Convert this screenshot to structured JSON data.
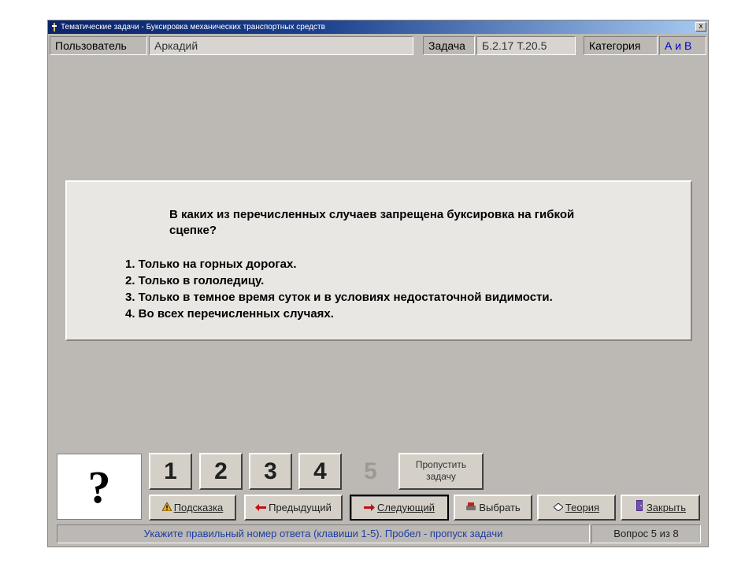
{
  "window": {
    "title": "Тематические задачи - Буксировка механических транспортных средств",
    "close_label": "x"
  },
  "infobar": {
    "user_label": "Пользователь",
    "user_value": "Аркадий",
    "task_label": "Задача",
    "task_value": "Б.2.17  Т.20.5",
    "category_label": "Категория",
    "category_value": "А и В"
  },
  "question": {
    "text": "В каких из перечисленных случаев запрещена буксировка на гибкой сцепке?",
    "answers": [
      "1. Только на горных дорогах.",
      "2. Только в гололедицу.",
      "3. Только в темное время суток и в условиях недостаточной видимости.",
      "4. Во всех перечисленных случаях."
    ]
  },
  "answer_area": {
    "selected_symbol": "?",
    "numbers": [
      "1",
      "2",
      "3",
      "4",
      "5"
    ],
    "skip_label_line1": "Пропустить",
    "skip_label_line2": "задачу"
  },
  "actions": {
    "hint": "Подсказка",
    "prev": "Предыдущий",
    "next": "Следующий",
    "choose": "Выбрать",
    "theory": "Теория",
    "close": "Закрыть"
  },
  "status": {
    "instruction": "Укажите правильный номер ответа (клавиши 1-5). Пробел - пропуск задачи",
    "progress": "Вопрос 5 из 8"
  },
  "colors": {
    "window_bg": "#bcb8b4",
    "title_bar": "#0a246a",
    "accent_text": "#0000c8",
    "status_text": "#1f3fa0"
  }
}
